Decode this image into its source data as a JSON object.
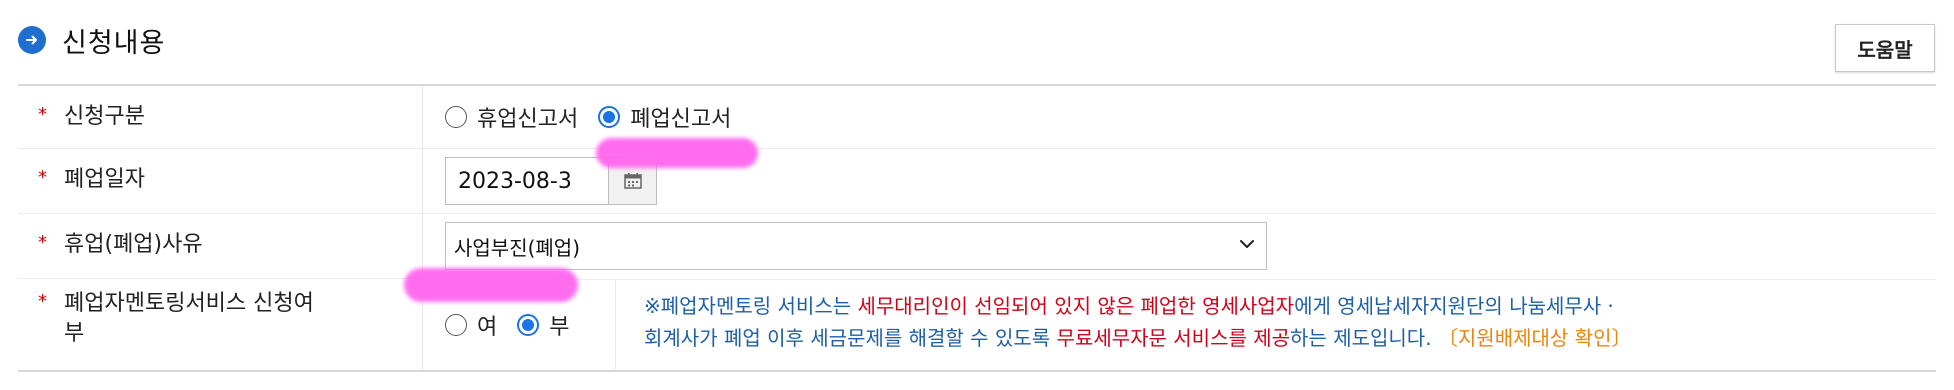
{
  "section": {
    "title": "신청내용",
    "icon": "arrow-right-circle-icon"
  },
  "help_button": {
    "label": "도움말"
  },
  "required_mark": "*",
  "rows": {
    "application_type": {
      "label": "신청구분",
      "options": [
        {
          "label": "휴업신고서",
          "checked": false
        },
        {
          "label": "폐업신고서",
          "checked": true
        }
      ]
    },
    "closure_date": {
      "label": "폐업일자",
      "value": "2023-08-3",
      "icon": "calendar-icon"
    },
    "reason": {
      "label": "휴업(폐업)사유",
      "selected": "사업부진(폐업)"
    },
    "mentoring": {
      "label_line1": "폐업자멘토링서비스 신청여",
      "label_line2": "부",
      "options": [
        {
          "label": "여",
          "checked": false
        },
        {
          "label": "부",
          "checked": true
        }
      ],
      "note": {
        "p1": "※폐업자멘토링 서비스는 ",
        "p2": "세무대리인이 선임되어 있지 않은 폐업한 영세사업자",
        "p3": "에게 영세납세자지원단의 나눔세무사ㆍ",
        "p4": "회계사가 폐업 이후 세금문제를 해결할 수 있도록 ",
        "p5": "무료세무자문 서비스를 제공",
        "p6": "하는 제도입니다. ",
        "link": "〔지원배제대상 확인〕"
      }
    }
  },
  "colors": {
    "accent": "#1a73e8",
    "required": "#d40000",
    "note_blue": "#1e5fa8",
    "note_red": "#d0021b",
    "note_orange": "#e8870d",
    "redaction": "#ff66ee"
  }
}
